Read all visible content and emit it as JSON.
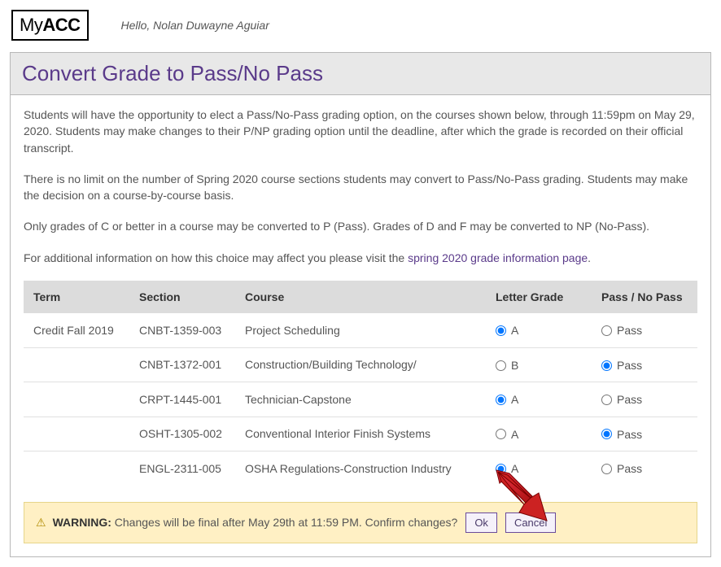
{
  "logo": {
    "prefix": "My",
    "bold": "ACC"
  },
  "greeting": "Hello, Nolan Duwayne Aguiar",
  "panel_title": "Convert Grade to Pass/No Pass",
  "intro_p1": "Students will have the opportunity to elect a Pass/No-Pass grading option, on the courses shown below, through 11:59pm on May 29, 2020. Students may make changes to their P/NP grading option until the deadline, after which the grade is recorded on their official transcript.",
  "intro_p2": "There is no limit on the number of Spring 2020 course sections students may convert to Pass/No-Pass grading. Students may make the decision on a course-by-course basis.",
  "intro_p3": "Only grades of C or better in a course may be converted to P (Pass). Grades of D and F may be converted to NP (No-Pass).",
  "intro_p4_prefix": "For additional information on how this choice may affect you please visit the ",
  "intro_p4_link": "spring 2020 grade information page",
  "intro_p4_suffix": ".",
  "table": {
    "headers": {
      "term": "Term",
      "section": "Section",
      "course": "Course",
      "letter": "Letter Grade",
      "pnp": "Pass / No Pass"
    },
    "rows": [
      {
        "term": "Credit Fall 2019",
        "section": "CNBT-1359-003",
        "course": "Project Scheduling",
        "letter_label": "A",
        "letter_selected": true,
        "pnp_label": "Pass",
        "pnp_selected": false
      },
      {
        "term": "",
        "section": "CNBT-1372-001",
        "course": "Construction/Building Technology/",
        "letter_label": "B",
        "letter_selected": false,
        "pnp_label": "Pass",
        "pnp_selected": true
      },
      {
        "term": "",
        "section": "CRPT-1445-001",
        "course": "Technician-Capstone",
        "letter_label": "A",
        "letter_selected": true,
        "pnp_label": "Pass",
        "pnp_selected": false
      },
      {
        "term": "",
        "section": "OSHT-1305-002",
        "course": "Conventional Interior Finish Systems",
        "letter_label": "A",
        "letter_selected": false,
        "pnp_label": "Pass",
        "pnp_selected": true
      },
      {
        "term": "",
        "section": "ENGL-2311-005",
        "course": "OSHA Regulations-Construction Industry",
        "letter_label": "A",
        "letter_selected": true,
        "pnp_label": "Pass",
        "pnp_selected": false
      }
    ]
  },
  "warning": {
    "label": "WARNING:",
    "text": "Changes will be final after May 29th at 11:59 PM. Confirm changes?",
    "ok": "Ok",
    "cancel": "Cancel"
  }
}
